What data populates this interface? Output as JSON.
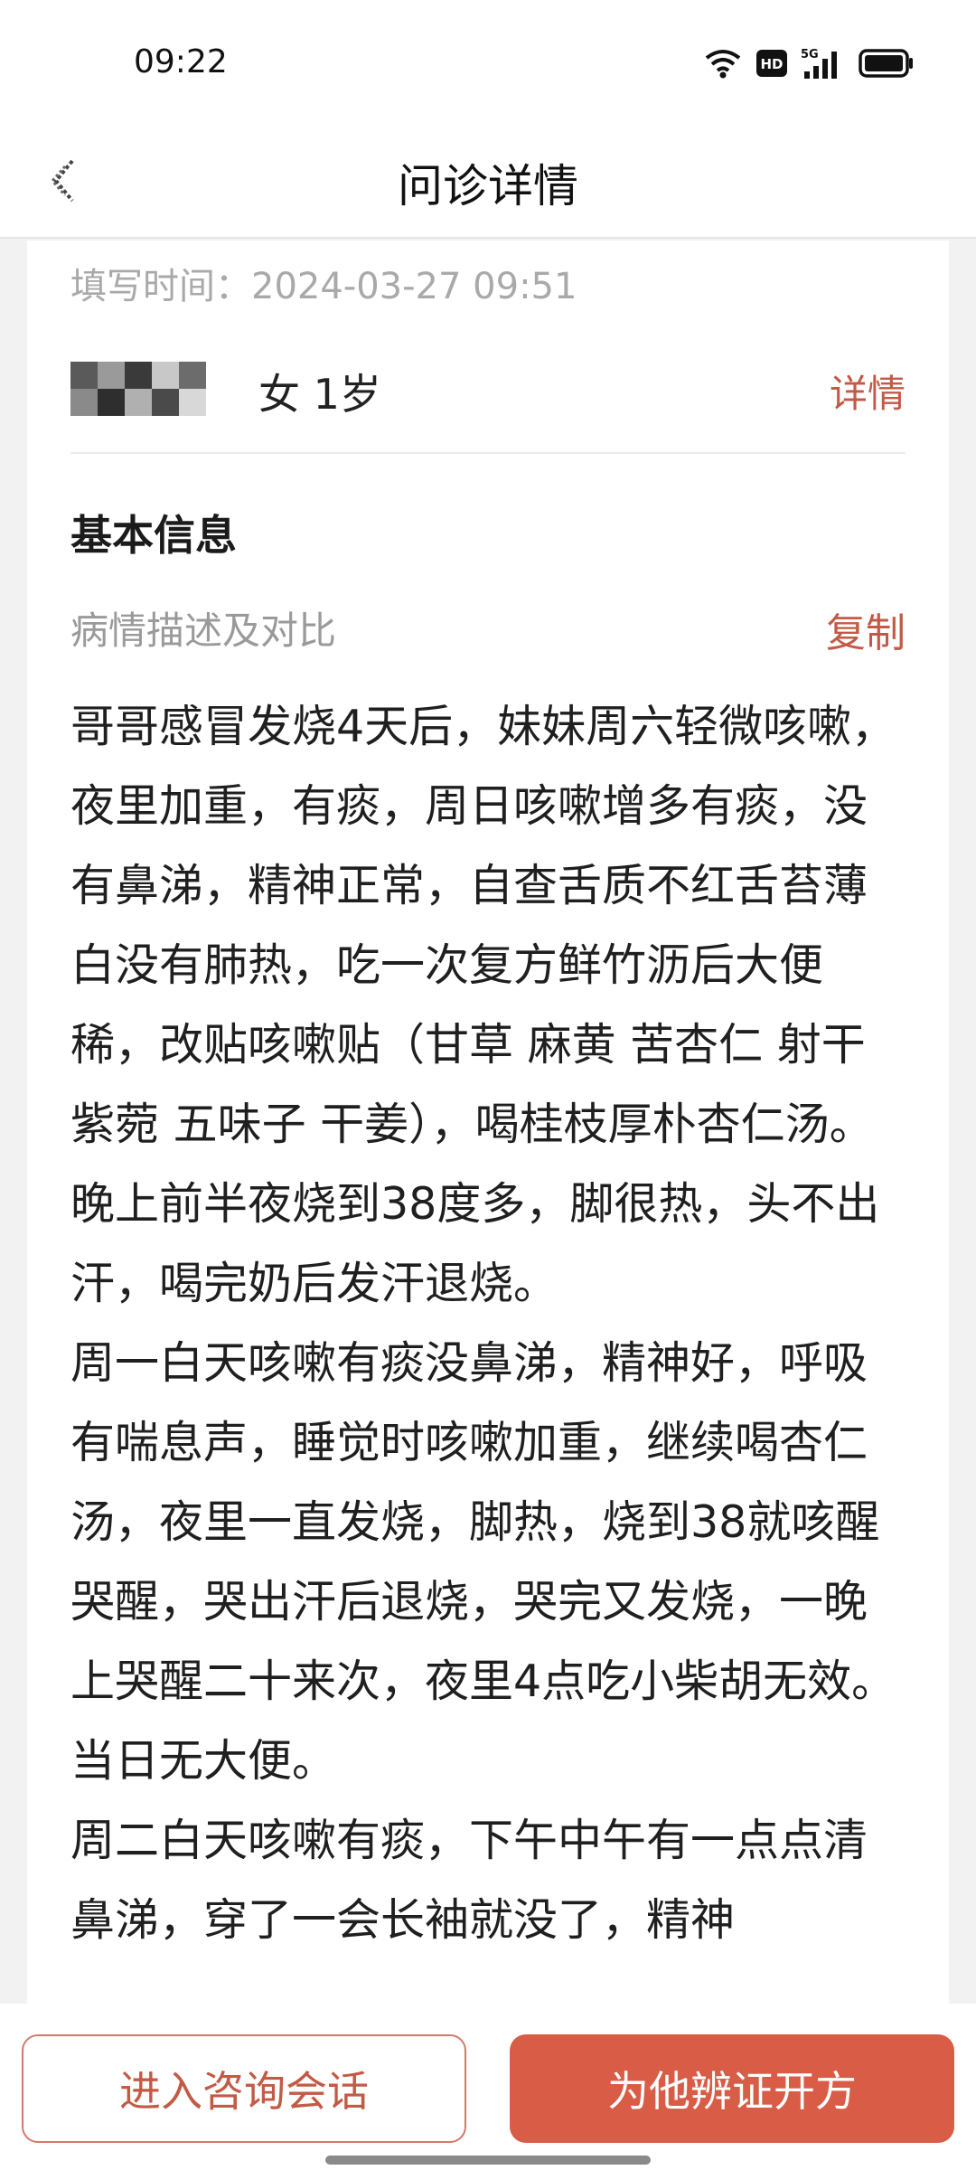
{
  "status_bar": {
    "time": "09:22",
    "icons": [
      "wifi-icon",
      "hd-icon",
      "signal-5g-icon",
      "battery-icon"
    ],
    "hd_label": "HD",
    "network_label": "5G"
  },
  "nav": {
    "title": "问诊详情",
    "back_icon": "back-arrow-icon"
  },
  "record": {
    "fill_time": "填写时间：2024-03-27 09:51",
    "patient": {
      "info": "女 1岁",
      "detail_label": "详情"
    },
    "section_title": "基本信息",
    "description_label": "病情描述及对比",
    "copy_label": "复制",
    "description_paragraphs": [
      "哥哥感冒发烧4天后，妹妹周六轻微咳嗽，夜里加重，有痰，周日咳嗽增多有痰，没有鼻涕，精神正常，自查舌质不红舌苔薄白没有肺热，吃一次复方鲜竹沥后大便稀，改贴咳嗽贴（甘草 麻黄 苦杏仁 射干 紫菀 五味子 干姜），喝桂枝厚朴杏仁汤。晚上前半夜烧到38度多，脚很热，头不出汗，喝完奶后发汗退烧。",
      "周一白天咳嗽有痰没鼻涕，精神好，呼吸有喘息声，睡觉时咳嗽加重，继续喝杏仁汤，夜里一直发烧，脚热，烧到38就咳醒哭醒，哭出汗后退烧，哭完又发烧，一晚上哭醒二十来次，夜里4点吃小柴胡无效。当日无大便。",
      "周二白天咳嗽有痰，下午中午有一点点清鼻涕，穿了一会长袖就没了，精神"
    ]
  },
  "actions": {
    "consult_label": "进入咨询会话",
    "prescribe_label": "为他辨证开方"
  },
  "colors": {
    "accent": "#d95c47",
    "accent_text": "#c35a45",
    "muted_text": "#9a9a9a"
  }
}
